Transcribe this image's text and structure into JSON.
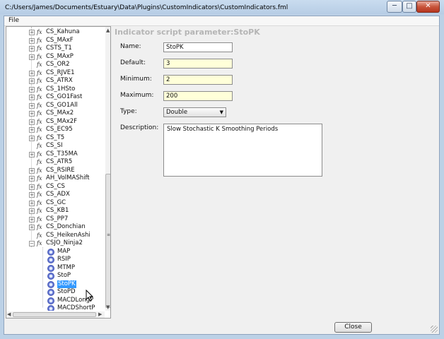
{
  "window": {
    "title": "C:/Users/James/Documents/Estuary\\Data\\Plugins\\CustomIndicators\\CustomIndicators.fml",
    "minimize_glyph": "─",
    "maximize_glyph": "□",
    "close_glyph": "✕"
  },
  "menu": {
    "file": "File"
  },
  "tree": {
    "indicators": [
      {
        "name": "CS_Kahuna",
        "expandable": true
      },
      {
        "name": "CS_MAxF",
        "expandable": true
      },
      {
        "name": "CSTS_T1",
        "expandable": true
      },
      {
        "name": "CS_MAxP",
        "expandable": true
      },
      {
        "name": "CS_OR2",
        "expandable": false
      },
      {
        "name": "CS_RJVE1",
        "expandable": true
      },
      {
        "name": "CS_ATRX",
        "expandable": true
      },
      {
        "name": "CS_1HSto",
        "expandable": true
      },
      {
        "name": "CS_GO1Fast",
        "expandable": true
      },
      {
        "name": "CS_GO1All",
        "expandable": true
      },
      {
        "name": "CS_MAx2",
        "expandable": true
      },
      {
        "name": "CS_MAx2F",
        "expandable": true
      },
      {
        "name": "CS_EC95",
        "expandable": true
      },
      {
        "name": "CS_T5",
        "expandable": true
      },
      {
        "name": "CS_SI",
        "expandable": false
      },
      {
        "name": "CS_T35MA",
        "expandable": true
      },
      {
        "name": "CS_ATR5",
        "expandable": false
      },
      {
        "name": "CS_RSIRE",
        "expandable": true
      },
      {
        "name": "AH_VolMAShift",
        "expandable": true
      },
      {
        "name": "CS_CS",
        "expandable": true
      },
      {
        "name": "CS_ADX",
        "expandable": true
      },
      {
        "name": "CS_GC",
        "expandable": true
      },
      {
        "name": "CS_KB1",
        "expandable": true
      },
      {
        "name": "CS_PP7",
        "expandable": true
      },
      {
        "name": "CS_Donchian",
        "expandable": true
      },
      {
        "name": "CS_HeikenAshi",
        "expandable": false
      },
      {
        "name": "CSJO_Ninja2",
        "expandable": true
      }
    ],
    "params": [
      "MAP",
      "RSIP",
      "MTMP",
      "StoP",
      "StoPK",
      "StoPD",
      "MACDLongP",
      "MACDShortP"
    ],
    "selected": "StoPK",
    "fx_glyph": "fx",
    "expand_glyph": "+",
    "collapse_glyph": "−"
  },
  "form": {
    "heading": "Indicator script parameter:StoPK",
    "name_label": "Name:",
    "name_value": "StoPK",
    "default_label": "Default:",
    "default_value": "3",
    "minimum_label": "Minimum:",
    "minimum_value": "2",
    "maximum_label": "Maximum:",
    "maximum_value": "200",
    "type_label": "Type:",
    "type_value": "Double",
    "description_label": "Description:",
    "description_value": "Slow Stochastic K Smoothing Periods"
  },
  "footer": {
    "close_label": "Close"
  }
}
